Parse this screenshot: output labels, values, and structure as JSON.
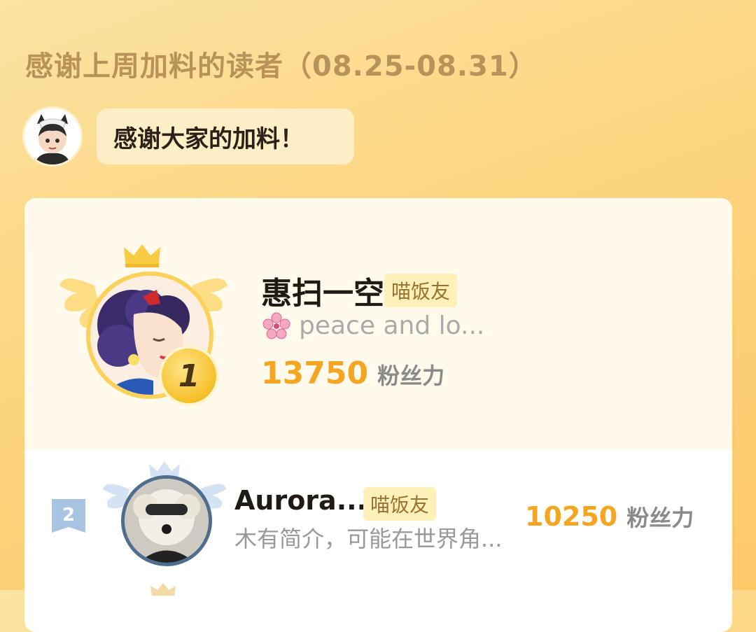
{
  "header": {
    "title": "感谢上周加料的读者（08.25-08.31）"
  },
  "message": {
    "text": "感谢大家的加料！"
  },
  "ranking": [
    {
      "rank": "1",
      "name": "惠扫一空",
      "tag": "喵饭友",
      "bio": "peace and lo...",
      "bio_icon": "cherry-blossom-icon",
      "score": "13750",
      "score_unit": "粉丝力"
    },
    {
      "rank": "2",
      "name": "Aurora...",
      "tag": "喵饭友",
      "bio": "木有简介，可能在世界角...",
      "score": "10250",
      "score_unit": "粉丝力"
    }
  ],
  "colors": {
    "background": "#fcd57f",
    "title": "#b9925a",
    "score": "#f4a622",
    "gold": "#f6c028",
    "silver_blue": "#4f6e8e"
  }
}
